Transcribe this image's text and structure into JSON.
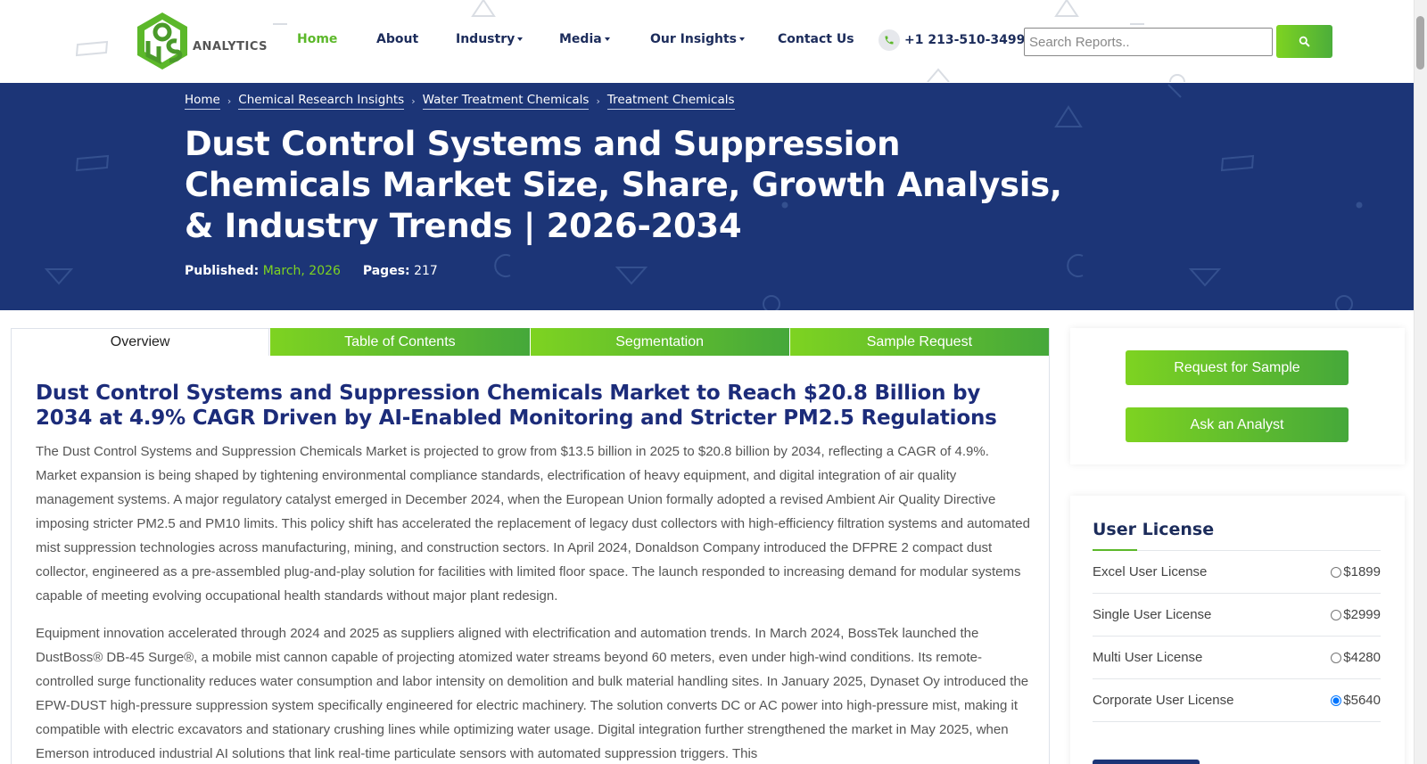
{
  "header": {
    "logo_text": "ANALYTICS",
    "nav": [
      {
        "label": "Home",
        "active": true,
        "dropdown": false
      },
      {
        "label": "About",
        "active": false,
        "dropdown": false
      },
      {
        "label": "Industry",
        "active": false,
        "dropdown": true
      },
      {
        "label": "Media",
        "active": false,
        "dropdown": true
      },
      {
        "label": "Our Insights",
        "active": false,
        "dropdown": true
      },
      {
        "label": "Contact Us",
        "active": false,
        "dropdown": false
      }
    ],
    "phone": "+1 213-510-3499",
    "phone_icon": "phone-icon",
    "search_placeholder": "Search Reports..",
    "search_icon": "search-icon"
  },
  "breadcrumb": [
    "Home",
    "Chemical Research Insights",
    "Water Treatment Chemicals",
    "Treatment Chemicals"
  ],
  "hero": {
    "title": "Dust Control Systems and Suppression Chemicals Market Size, Share, Growth Analysis, & Industry Trends | 2026-2034",
    "published_label": "Published:",
    "published_value": "March, 2026",
    "pages_label": "Pages:",
    "pages_value": "217"
  },
  "tabs": [
    {
      "label": "Overview",
      "active": true
    },
    {
      "label": "Table of Contents",
      "active": false
    },
    {
      "label": "Segmentation",
      "active": false
    },
    {
      "label": "Sample Request",
      "active": false
    }
  ],
  "content": {
    "heading": "Dust Control Systems and Suppression Chemicals Market to Reach $20.8 Billion by 2034 at 4.9% CAGR Driven by AI-Enabled Monitoring and Stricter PM2.5 Regulations",
    "paragraph1": "The Dust Control Systems and Suppression Chemicals Market is projected to grow from $13.5 billion in 2025 to $20.8 billion by 2034, reflecting a CAGR of 4.9%. Market expansion is being shaped by tightening environmental compliance standards, electrification of heavy equipment, and digital integration of air quality management systems. A major regulatory catalyst emerged in December 2024, when the European Union formally adopted a revised Ambient Air Quality Directive imposing stricter PM2.5 and PM10 limits. This policy shift has accelerated the replacement of legacy dust collectors with high-efficiency filtration systems and automated mist suppression technologies across manufacturing, mining, and construction sectors. In April 2024, Donaldson Company introduced the DFPRE 2 compact dust collector, engineered as a pre-assembled plug-and-play solution for facilities with limited floor space. The launch responded to increasing demand for modular systems capable of meeting evolving occupational health standards without major plant redesign.",
    "paragraph2": "Equipment innovation accelerated through 2024 and 2025 as suppliers aligned with electrification and automation trends. In March 2024, BossTek launched the DustBoss® DB-45 Surge®, a mobile mist cannon capable of projecting atomized water streams beyond 60 meters, even under high-wind conditions. Its remote-controlled surge functionality reduces water consumption and labor intensity on demolition and bulk material handling sites. In January 2025, Dynaset Oy introduced the EPW-DUST high-pressure suppression system specifically engineered for electric machinery. The solution converts DC or AC power into high-pressure mist, making it compatible with electric excavators and stationary crushing lines while optimizing water usage. Digital integration further strengthened the market in May 2025, when Emerson introduced industrial AI solutions that link real-time particulate sensors with automated suppression triggers. This"
  },
  "sidebar": {
    "request_sample": "Request for Sample",
    "ask_analyst": "Ask an Analyst",
    "license_title": "User License",
    "licenses": [
      {
        "name": "Excel User License",
        "price": "$1899",
        "selected": false
      },
      {
        "name": "Single User License",
        "price": "$2999",
        "selected": false
      },
      {
        "name": "Multi User License",
        "price": "$4280",
        "selected": false
      },
      {
        "name": "Corporate User License",
        "price": "$5640",
        "selected": true
      }
    ]
  },
  "colors": {
    "navy": "#1c3577",
    "green": "#5cb82a",
    "heading": "#1c2c7a"
  }
}
